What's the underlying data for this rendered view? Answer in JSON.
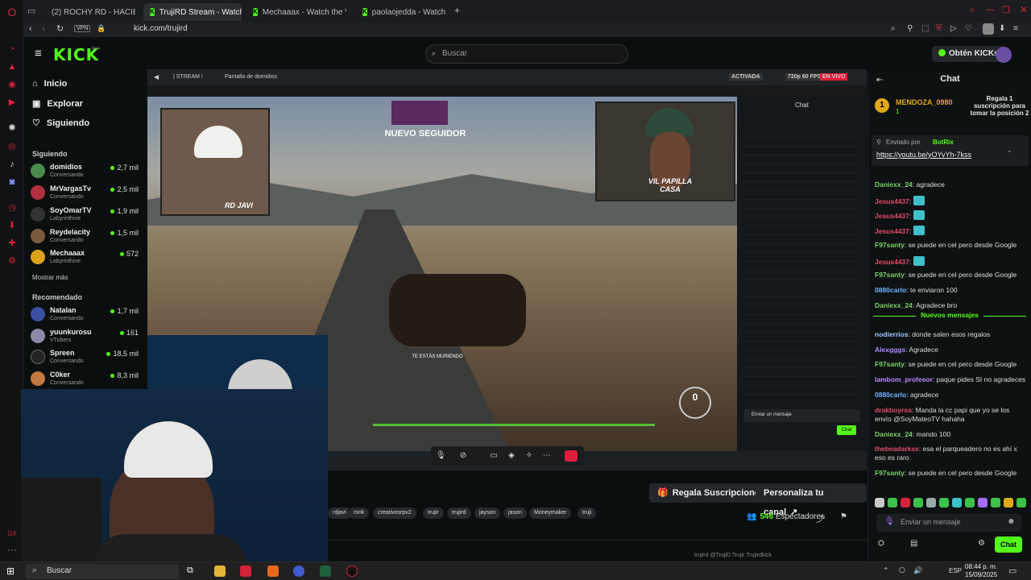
{
  "browser": {
    "tabs": [
      {
        "label": "(2) ROCHY RD - HACIEN"
      },
      {
        "label": "TrujiRD Stream - Watch L"
      },
      {
        "label": "Mechaaax - Watch the V"
      },
      {
        "label": "paolaojedda - Watch the"
      }
    ],
    "vpn": "VPN",
    "url": "kick.com/trujird"
  },
  "kick": {
    "logo": "KICK",
    "beta": "BETA",
    "search_placeholder": "Buscar",
    "get_kicks": "Obtén KICKs",
    "nav": [
      "Inicio",
      "Explorar",
      "Siguiendo"
    ],
    "following_title": "Siguiendo",
    "following": [
      {
        "name": "domidios",
        "game": "Conversando",
        "viewers": "2,7 mil"
      },
      {
        "name": "MrVargasTv",
        "game": "Conversando",
        "viewers": "2,5 mil"
      },
      {
        "name": "SoyOmarTV",
        "game": "Labyrinthine",
        "viewers": "1,9 mil"
      },
      {
        "name": "Reydelacity",
        "game": "Conversando",
        "viewers": "1,5 mil"
      },
      {
        "name": "Mechaaax",
        "game": "Labyrinthine",
        "viewers": "572"
      }
    ],
    "show_more": "Mostrar más",
    "recommended_title": "Recomendado",
    "recommended": [
      {
        "name": "Natalan",
        "game": "Conversando",
        "viewers": "1,7 mil"
      },
      {
        "name": "yuunkurosu",
        "game": "VTubers",
        "viewers": "161"
      },
      {
        "name": "Spreen",
        "game": "Conversando",
        "viewers": "18,5 mil"
      },
      {
        "name": "C0ker",
        "game": "Conversando",
        "viewers": "8,3 mil"
      }
    ]
  },
  "stream": {
    "nested_bar_left": "| STREAM !",
    "nested_screen": "Pantalla de domidios",
    "activated": "ACTIVADA",
    "quality": "720p 60 FPS",
    "live": "EN VIVO",
    "new_follower": "NUEVO SEGUIDOR",
    "cam_label_left": "RD JAVI",
    "cam_label_right": "VIL PAPILLA CASA",
    "death_text": "TE ESTÁS MURIENDO",
    "nested_chat_title": "Chat",
    "nested_chat_input": "Enviar un mensaje",
    "nested_chat_send": "Chat",
    "counter": "0"
  },
  "below": {
    "gift_subs": "Regala Suscripciones",
    "customize": "Personaliza tu canal",
    "tags": [
      "rdjavi",
      "mnk",
      "creativosrpv2",
      "trujir",
      "trujird",
      "jayson",
      "jason",
      "Moneymaker",
      "truji"
    ],
    "viewers_count": "546",
    "viewers_label": "Espectadores",
    "socials": "trujird  @TrujiD  Trujir  Trujirdkick"
  },
  "chat": {
    "title": "Chat",
    "gift_user": "MENDOZA_0980",
    "gift_count": "1",
    "gift_cta": "Regala 1 suscripción para tomar la posición 2",
    "pinned_by": "Enviado por",
    "pinned_user": "BotRix",
    "pinned_link": "https://youtu.be/yOYvYh-7kss",
    "messages": [
      {
        "user": "Daniexx_24",
        "color": "#7bd36a",
        "text": "agradece"
      },
      {
        "user": "Jesus4437",
        "color": "#e34a6b",
        "text": ""
      },
      {
        "user": "Jesus4437",
        "color": "#e34a6b",
        "text": ""
      },
      {
        "user": "Jesus4437",
        "color": "#e34a6b",
        "text": ""
      },
      {
        "user": "F97santy",
        "color": "#7bd36a",
        "text": "se puede en cel pero desde Google"
      },
      {
        "user": "Jesus4437",
        "color": "#e34a6b",
        "text": ""
      },
      {
        "user": "F97santy",
        "color": "#7bd36a",
        "text": "se puede en cel pero desde Google"
      },
      {
        "user": "0880carlo",
        "color": "#6fb4ff",
        "text": "te enviaron 100"
      },
      {
        "user": "Daniexx_24",
        "color": "#7bd36a",
        "text": "Agradece bro"
      }
    ],
    "new_messages": "Nuevos mensajes",
    "messages2": [
      {
        "user": "nodierrios",
        "color": "#9fc7ff",
        "text": "donde salen esos regalos"
      },
      {
        "user": "Alexgggs",
        "color": "#a98bff",
        "text": "Agradece"
      },
      {
        "user": "F97santy",
        "color": "#7bd36a",
        "text": "se puede en cel pero desde Google"
      },
      {
        "user": "lambom_profesor",
        "color": "#b48cff",
        "text": "paque pides SI no agradeces"
      },
      {
        "user": "0880carlo",
        "color": "#6fb4ff",
        "text": "agradece"
      },
      {
        "user": "drakboyrsa",
        "color": "#e34a6b",
        "text": "Manda la cc papi que yo se los envío @SoyMateoTV hahaha"
      },
      {
        "user": "Daniexx_24",
        "color": "#7bd36a",
        "text": "mando 100"
      },
      {
        "user": "thebeadarkss",
        "color": "#e34a6b",
        "text": "esa el parqueadero no es ahí x eso es raro"
      },
      {
        "user": "F97santy",
        "color": "#7bd36a",
        "text": "se puede en cel pero desde Google"
      }
    ],
    "input_placeholder": "Enviar un mensaje",
    "send_button": "Chat"
  },
  "taskbar": {
    "search": "Buscar",
    "lang": "ESP",
    "time": "08:44 p. m.",
    "date": "15/09/2025"
  }
}
